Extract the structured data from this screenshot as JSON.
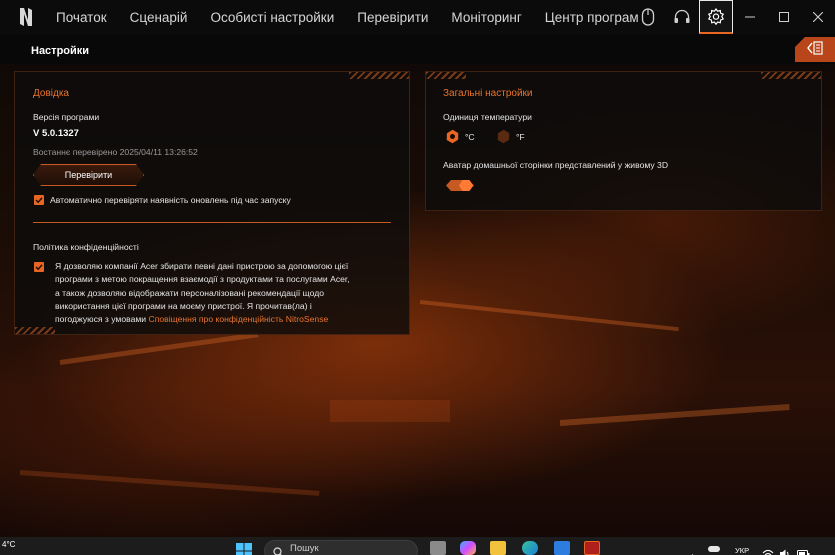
{
  "nav": {
    "items": [
      "Початок",
      "Сценарій",
      "Особисті настройки",
      "Перевірити",
      "Моніторинг",
      "Центр програм"
    ]
  },
  "icons": {
    "logo": "nitro-logo-icon",
    "mouse": "mouse-icon",
    "headset": "headset-icon",
    "settings": "gear-icon",
    "collapse": "panel-collapse-icon"
  },
  "titlebar": {
    "title": "Настройки"
  },
  "help": {
    "heading": "Довідка",
    "version_label": "Версія програми",
    "version_value": "V 5.0.1327",
    "last_checked": "Востаннє перевірено 2025/04/11 13:26:52",
    "check_button": "Перевірити",
    "auto_check_label": "Автоматично перевіряти наявність оновлень під час запуску",
    "auto_check": true,
    "privacy_title": "Політика конфіденційності",
    "privacy_consent": true,
    "privacy_lines": [
      "Я дозволяю компанії Acer збирати певні дані пристрою за допомогою цієї",
      "програми з метою покращення взаємодії з продуктами та послугами Acer,",
      "а також дозволяю відображати персоналізовані рекомендації щодо",
      "використання цієї програми на моєму пристрої. Я прочитав(ла) і"
    ],
    "privacy_last_prefix": "погоджуюся з умовами ",
    "privacy_link": "Сповіщення про конфіденційність NitroSense"
  },
  "general": {
    "heading": "Загальні настройки",
    "temp_unit_label": "Одиниця температури",
    "unit_c": "°C",
    "unit_f": "°F",
    "selected_unit": "°C",
    "avatar_label": "Аватар домашньої сторінки представлений у живому 3D",
    "avatar_enabled": true
  },
  "taskbar": {
    "temperature": "4°C",
    "search_placeholder": "Пошук",
    "language": "УКР"
  },
  "colors": {
    "accent": "#e86524",
    "heading": "#e8742e",
    "topbar": "#0b0b0b"
  }
}
